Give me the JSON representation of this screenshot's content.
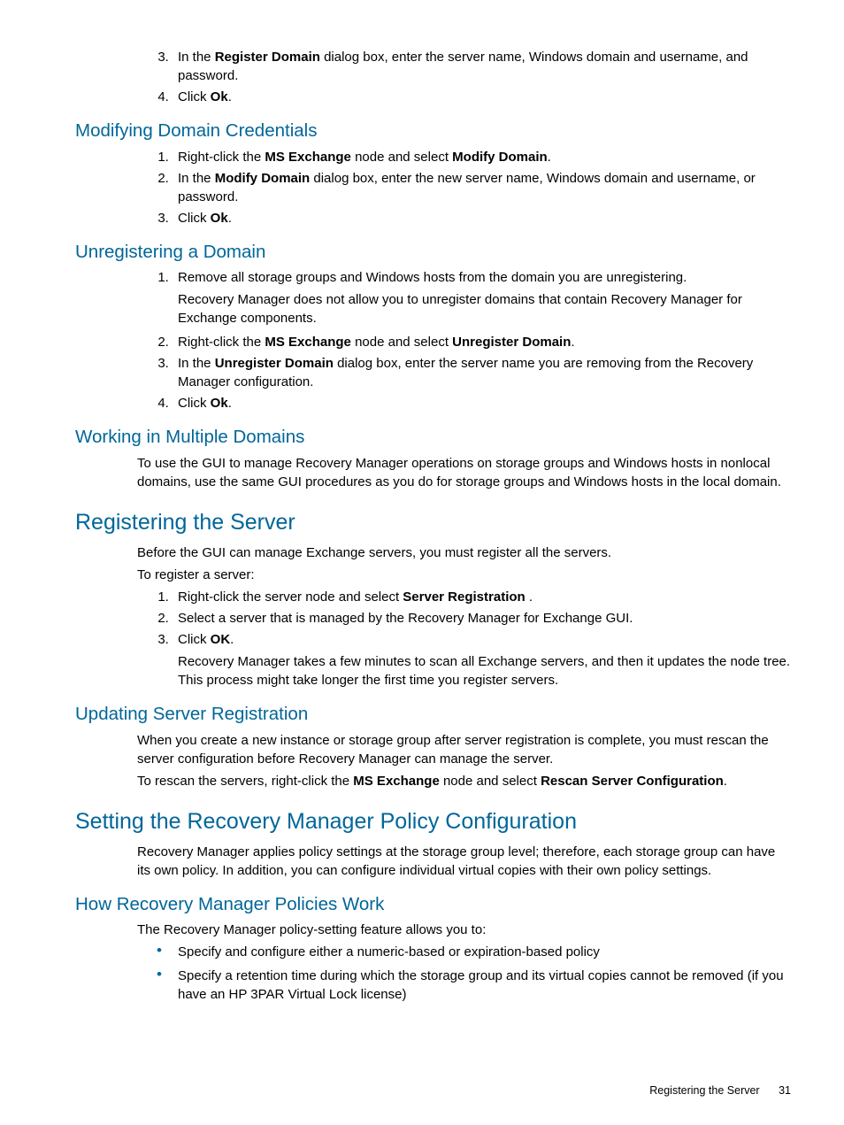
{
  "initialSteps": {
    "step3_marker": "3.",
    "step3_pre": "In the ",
    "step3_b1": "Register Domain",
    "step3_post": " dialog box, enter the server name, Windows domain and username, and password.",
    "step4_marker": "4.",
    "step4_pre": "Click ",
    "step4_b1": "Ok",
    "step4_post": "."
  },
  "modifying": {
    "title": "Modifying Domain Credentials",
    "s1_pre": "Right-click the ",
    "s1_b1": "MS Exchange",
    "s1_mid": " node and select ",
    "s1_b2": "Modify Domain",
    "s1_post": ".",
    "s2_pre": "In the ",
    "s2_b1": "Modify Domain",
    "s2_post": " dialog box, enter the new server name, Windows domain and username, or password.",
    "s3_pre": "Click ",
    "s3_b1": "Ok",
    "s3_post": "."
  },
  "unregistering": {
    "title": "Unregistering a Domain",
    "s1": "Remove all storage groups and Windows hosts from the domain you are unregistering.",
    "s1_note": "Recovery Manager does not allow you to unregister domains that contain Recovery Manager for Exchange components.",
    "s2_pre": "Right-click the ",
    "s2_b1": "MS Exchange",
    "s2_mid": " node and select ",
    "s2_b2": "Unregister Domain",
    "s2_post": ".",
    "s3_pre": "In the ",
    "s3_b1": "Unregister Domain",
    "s3_post": " dialog box, enter the server name you are removing from the Recovery Manager configuration.",
    "s4_pre": "Click ",
    "s4_b1": "Ok",
    "s4_post": "."
  },
  "working": {
    "title": "Working in Multiple Domains",
    "p1": "To use the GUI to manage Recovery Manager operations on storage groups and Windows hosts in nonlocal domains, use the same GUI procedures as you do for storage groups and Windows hosts in the local domain."
  },
  "registering": {
    "title": "Registering the Server",
    "p1": "Before the GUI can manage Exchange servers, you must register all the servers.",
    "p2": "To register a server:",
    "s1_pre": "Right-click the server node and select ",
    "s1_b1": "Server Registration",
    "s1_post": " .",
    "s2": "Select a server that is managed by the Recovery Manager for Exchange GUI.",
    "s3_pre": "Click ",
    "s3_b1": "OK",
    "s3_post": ".",
    "s3_note": "Recovery Manager takes a few minutes to scan all Exchange servers, and then it updates the node tree. This process might take longer the first time you register servers."
  },
  "updating": {
    "title": "Updating Server Registration",
    "p1": "When you create a new instance or storage group after server registration is complete, you must rescan the server configuration before Recovery Manager can manage the server.",
    "p2_pre": "To rescan the servers, right-click the ",
    "p2_b1": "MS Exchange",
    "p2_mid": " node and select ",
    "p2_b2": "Rescan Server Configuration",
    "p2_post": "."
  },
  "setting": {
    "title": "Setting the Recovery Manager Policy Configuration",
    "p1": "Recovery Manager applies policy settings at the storage group level; therefore, each storage group can have its own policy. In addition, you can configure individual virtual copies with their own policy settings."
  },
  "howPolicies": {
    "title": "How Recovery Manager Policies Work",
    "p1": "The Recovery Manager policy-setting feature allows you to:",
    "b1": "Specify and configure either a numeric-based or expiration-based policy",
    "b2": "Specify a retention time during which the storage group and its virtual copies cannot be removed (if you have an HP 3PAR Virtual Lock license)"
  },
  "footer": {
    "section": "Registering the Server",
    "page": "31"
  }
}
